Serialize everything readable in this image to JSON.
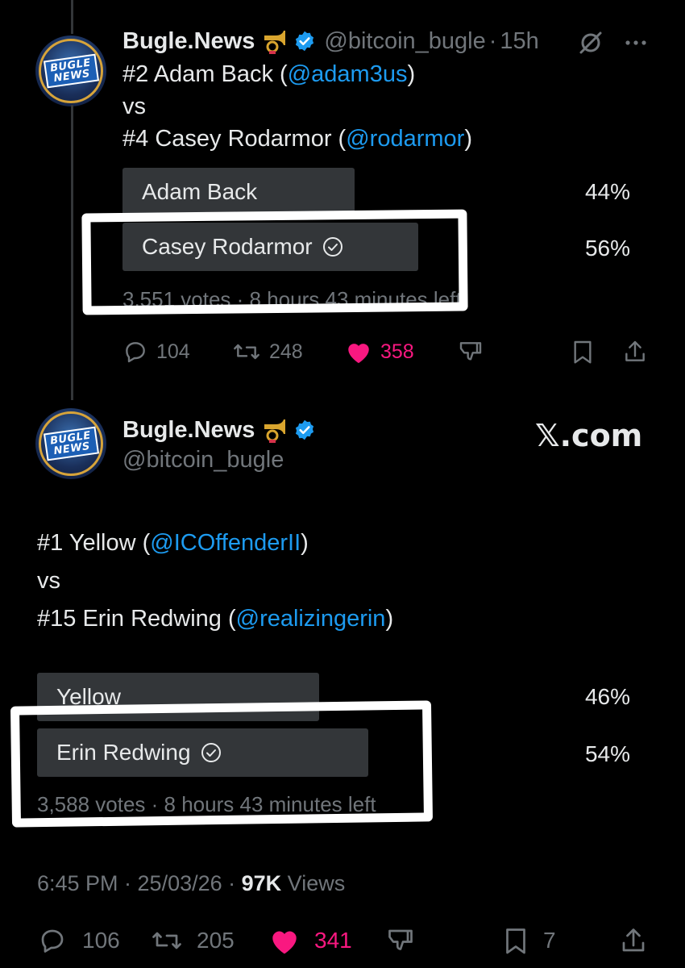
{
  "tweet1": {
    "name": "Bugle.News",
    "handle": "@bitcoin_bugle",
    "separator": "·",
    "time": "15h",
    "avatar_text_line1": "BUGLE",
    "avatar_text_line2": "NEWS",
    "body": {
      "line1_prefix": "#2 Adam Back (",
      "line1_mention": "@adam3us",
      "line1_suffix": ")",
      "line2": "vs",
      "line3_prefix": "#4 Casey Rodarmor (",
      "line3_mention": "@rodarmor",
      "line3_suffix": ")"
    },
    "poll": {
      "options": [
        {
          "label": "Adam Back",
          "percent_text": "44%",
          "percent": 44,
          "selected": false
        },
        {
          "label": "Casey Rodarmor",
          "percent_text": "56%",
          "percent": 56,
          "selected": true
        }
      ],
      "meta": "3,551 votes · 8 hours 43 minutes left"
    },
    "actions": {
      "replies": "104",
      "reposts": "248",
      "likes": "358"
    }
  },
  "tweet2": {
    "name": "Bugle.News",
    "handle": "@bitcoin_bugle",
    "avatar_text_line1": "BUGLE",
    "avatar_text_line2": "NEWS",
    "site": "𝕏.com",
    "body": {
      "line1_prefix": "#1 Yellow (",
      "line1_mention": "@ICOffenderII",
      "line1_suffix": ")",
      "line2": "vs",
      "line3_prefix": "#15 Erin Redwing (",
      "line3_mention": "@realizingerin",
      "line3_suffix": ")"
    },
    "poll": {
      "options": [
        {
          "label": "Yellow",
          "percent_text": "46%",
          "percent": 46,
          "selected": false
        },
        {
          "label": "Erin Redwing",
          "percent_text": "54%",
          "percent": 54,
          "selected": true
        }
      ],
      "meta": "3,588 votes · 8 hours 43 minutes left"
    },
    "timestamp": "6:45 PM · 25/03/26 · ",
    "views_count": "97K",
    "views_label": " Views",
    "actions": {
      "replies": "106",
      "reposts": "205",
      "likes": "341",
      "bookmarks": "7"
    }
  },
  "colors": {
    "background": "#000000",
    "text": "#e7e9ea",
    "muted": "#71767b",
    "mention": "#1d9bf0",
    "like": "#f91880",
    "poll_bar": "#333639",
    "verified": "#1d9bf0"
  },
  "icons": [
    "horn-icon",
    "verified-icon",
    "grok-icon",
    "more-icon",
    "reply-icon",
    "repost-icon",
    "like-icon",
    "analytics-icon",
    "bookmark-icon",
    "share-icon",
    "check-icon"
  ]
}
